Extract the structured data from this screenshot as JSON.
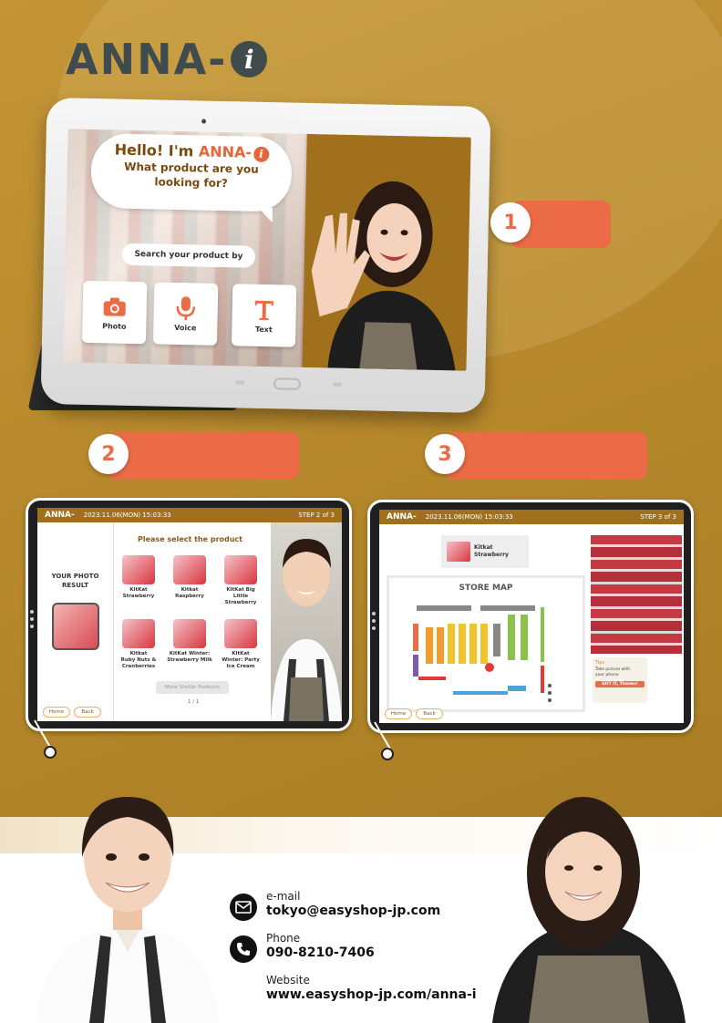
{
  "brand": {
    "logo_text": "ANNA-",
    "logo_i": "i"
  },
  "main_screen": {
    "greeting_prefix": "Hello! I'm ",
    "greeting_name": "ANNA-",
    "greeting_name_i": "i",
    "question_line1": "What product are you",
    "question_line2": "looking for?",
    "search_by_label": "Search your product by",
    "modes": [
      {
        "label": "Photo",
        "icon": "camera-icon"
      },
      {
        "label": "Voice",
        "icon": "microphone-icon"
      },
      {
        "label": "Text",
        "icon": "text-t-icon"
      }
    ]
  },
  "callouts": [
    {
      "number": "1"
    },
    {
      "number": "2"
    },
    {
      "number": "3"
    }
  ],
  "step2": {
    "bar_logo": "ANNA-",
    "bar_date": "2023.11.06(MON) 15:03:33",
    "bar_step": "STEP 2 of 3",
    "photo_result_line1": "YOUR PHOTO",
    "photo_result_line2": "RESULT",
    "select_title": "Please select the product",
    "products": [
      {
        "name_line1": "KitKat",
        "name_line2": "Strawberry",
        "name_line3": ""
      },
      {
        "name_line1": "Kitkat",
        "name_line2": "Raspberry",
        "name_line3": ""
      },
      {
        "name_line1": "KitKat Big",
        "name_line2": "Little",
        "name_line3": "Strawberry"
      },
      {
        "name_line1": "Kitkat",
        "name_line2": "Ruby Nuts &",
        "name_line3": "Cranberries"
      },
      {
        "name_line1": "KitKat Winter:",
        "name_line2": "Strawberry Milk",
        "name_line3": ""
      },
      {
        "name_line1": "KitKat",
        "name_line2": "Winter: Party",
        "name_line3": "Ice Cream"
      }
    ],
    "more_button": "More Similar Products",
    "pager": "1 / 1",
    "home_button": "Home",
    "back_button": "Back"
  },
  "step3": {
    "bar_logo": "ANNA-",
    "bar_date": "2023.11.06(MON) 15:03:33",
    "bar_step": "STEP 3 of 3",
    "item_name_line1": "Kitkat",
    "item_name_line2": "Strawberry",
    "map_title": "STORE MAP",
    "tips_title": "Tips",
    "tips_body_line1": "Take picture with",
    "tips_body_line2": "your phone",
    "tips_button": "GOT IT, Thanks!",
    "home_button": "Home",
    "back_button": "Back"
  },
  "contact": {
    "email_label": "e-mail",
    "email_value": "tokyo@easyshop-jp.com",
    "phone_label": "Phone",
    "phone_value": "090-8210-7406",
    "website_label": "Website",
    "website_value": "www.easyshop-jp.com/anna-i"
  },
  "colors": {
    "accent": "#ea6b45",
    "gold": "#b88a2e",
    "brown": "#a0701c",
    "logo": "#3f4b4c"
  }
}
